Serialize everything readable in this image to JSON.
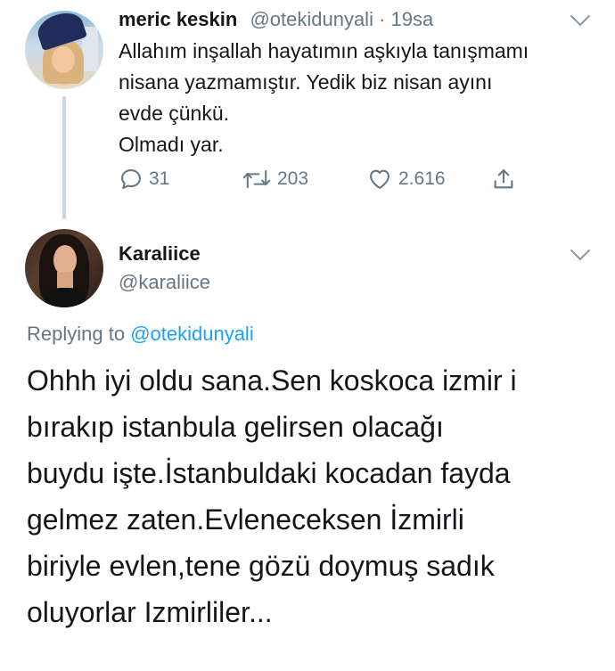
{
  "tweet1": {
    "author_name": "meric keskin",
    "handle": "@otekidunyali",
    "separator": " · ",
    "time": "19sa",
    "text_lines": [
      "Allahım inşallah hayatımın aşkıyla tanışmamı",
      "nisana yazmamıştır. Yedik biz nisan ayını",
      "evde çünkü.",
      "Olmadı yar."
    ],
    "actions": {
      "reply_count": "31",
      "retweet_count": "203",
      "like_count": "2.616"
    },
    "icons": {
      "reply": "reply-icon",
      "retweet": "retweet-icon",
      "like": "heart-icon",
      "share": "share-icon",
      "menu": "chevron-down-icon"
    }
  },
  "tweet2": {
    "author_name": "Karaliice",
    "handle": "@karaliice",
    "replying_prefix": "Replying to ",
    "replying_to": "@otekidunyali",
    "text_lines": [
      "Ohhh iyi oldu sana.Sen koskoca izmir i",
      "bırakıp istanbula gelirsen olacağı",
      "buydu işte.İstanbuldaki kocadan fayda",
      "gelmez zaten.Evleneceksen İzmirli",
      "biriyle evlen,tene gözü doymuş sadık",
      "oluyorlar Izmirliler..."
    ]
  },
  "colors": {
    "text": "#14171a",
    "secondary": "#657786",
    "link": "#1da1f2",
    "thread_line": "#ccd6dd"
  }
}
